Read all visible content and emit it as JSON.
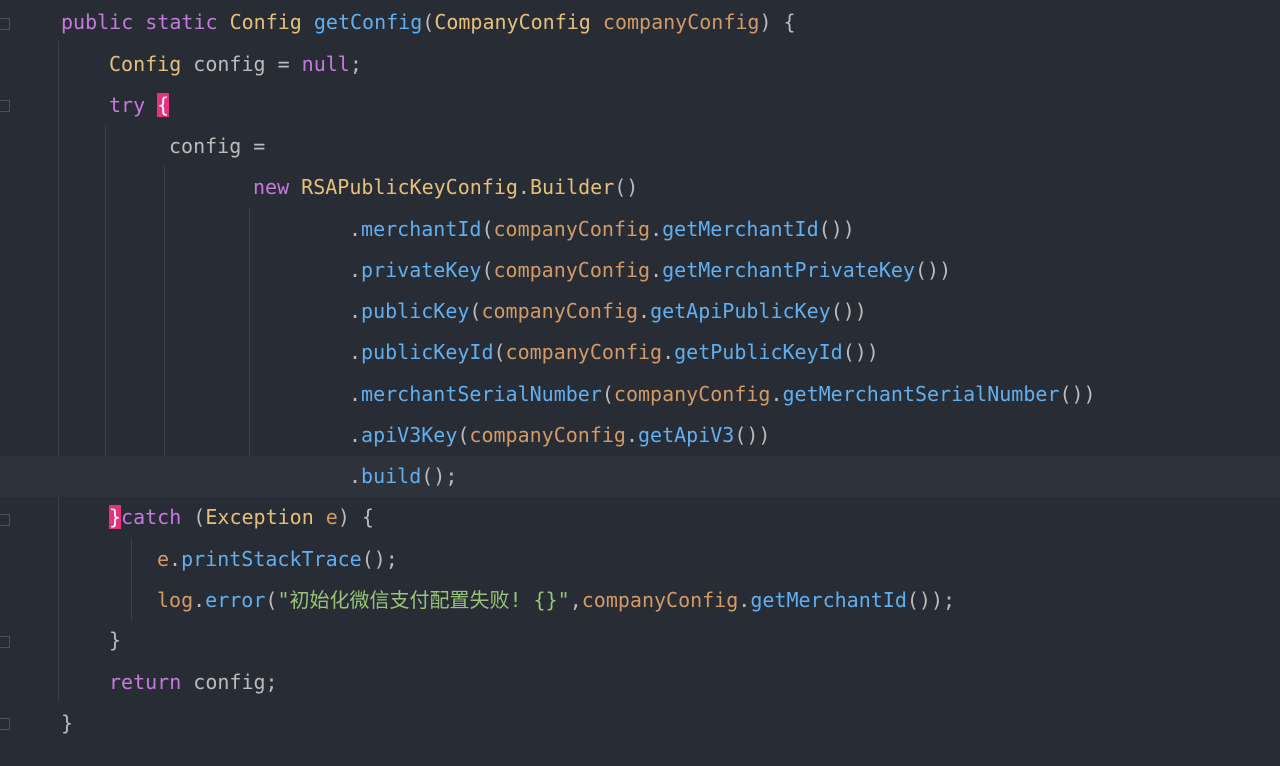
{
  "editor": {
    "lines": [
      {
        "tokens": [
          {
            "t": "public",
            "c": "kw"
          },
          {
            "t": " ",
            "c": "pl"
          },
          {
            "t": "static",
            "c": "kw"
          },
          {
            "t": " ",
            "c": "pl"
          },
          {
            "t": "Config",
            "c": "ty"
          },
          {
            "t": " ",
            "c": "pl"
          },
          {
            "t": "getConfig",
            "c": "fn"
          },
          {
            "t": "(",
            "c": "pl"
          },
          {
            "t": "CompanyConfig",
            "c": "ty"
          },
          {
            "t": " ",
            "c": "pl"
          },
          {
            "t": "companyConfig",
            "c": "pa"
          },
          {
            "t": ") {",
            "c": "pl"
          }
        ]
      },
      {
        "tokens": [
          {
            "t": "Config",
            "c": "ty"
          },
          {
            "t": " config = ",
            "c": "pl"
          },
          {
            "t": "null",
            "c": "kw"
          },
          {
            "t": ";",
            "c": "pl"
          }
        ]
      },
      {
        "tokens": [
          {
            "t": "try",
            "c": "kw"
          },
          {
            "t": " ",
            "c": "pl"
          },
          {
            "t": "{",
            "c": "brace-hl"
          }
        ]
      },
      {
        "tokens": [
          {
            "t": "config =",
            "c": "pl"
          }
        ]
      },
      {
        "tokens": [
          {
            "t": "new",
            "c": "kw"
          },
          {
            "t": " ",
            "c": "pl"
          },
          {
            "t": "RSAPublicKeyConfig",
            "c": "ty"
          },
          {
            "t": ".",
            "c": "pl"
          },
          {
            "t": "Builder",
            "c": "ty"
          },
          {
            "t": "()",
            "c": "pl"
          }
        ]
      },
      {
        "tokens": [
          {
            "t": ".",
            "c": "pl"
          },
          {
            "t": "merchantId",
            "c": "fn"
          },
          {
            "t": "(",
            "c": "pl"
          },
          {
            "t": "companyConfig",
            "c": "pa"
          },
          {
            "t": ".",
            "c": "pl"
          },
          {
            "t": "getMerchantId",
            "c": "fn"
          },
          {
            "t": "())",
            "c": "pl"
          }
        ]
      },
      {
        "tokens": [
          {
            "t": ".",
            "c": "pl"
          },
          {
            "t": "privateKey",
            "c": "fn"
          },
          {
            "t": "(",
            "c": "pl"
          },
          {
            "t": "companyConfig",
            "c": "pa"
          },
          {
            "t": ".",
            "c": "pl"
          },
          {
            "t": "getMerchantPrivateKey",
            "c": "fn"
          },
          {
            "t": "())",
            "c": "pl"
          }
        ]
      },
      {
        "tokens": [
          {
            "t": ".",
            "c": "pl"
          },
          {
            "t": "publicKey",
            "c": "fn"
          },
          {
            "t": "(",
            "c": "pl"
          },
          {
            "t": "companyConfig",
            "c": "pa"
          },
          {
            "t": ".",
            "c": "pl"
          },
          {
            "t": "getApiPublicKey",
            "c": "fn"
          },
          {
            "t": "())",
            "c": "pl"
          }
        ]
      },
      {
        "tokens": [
          {
            "t": ".",
            "c": "pl"
          },
          {
            "t": "publicKeyId",
            "c": "fn"
          },
          {
            "t": "(",
            "c": "pl"
          },
          {
            "t": "companyConfig",
            "c": "pa"
          },
          {
            "t": ".",
            "c": "pl"
          },
          {
            "t": "getPublicKeyId",
            "c": "fn"
          },
          {
            "t": "())",
            "c": "pl"
          }
        ]
      },
      {
        "tokens": [
          {
            "t": ".",
            "c": "pl"
          },
          {
            "t": "merchantSerialNumber",
            "c": "fn"
          },
          {
            "t": "(",
            "c": "pl"
          },
          {
            "t": "companyConfig",
            "c": "pa"
          },
          {
            "t": ".",
            "c": "pl"
          },
          {
            "t": "getMerchantSerialNumber",
            "c": "fn"
          },
          {
            "t": "())",
            "c": "pl"
          }
        ]
      },
      {
        "tokens": [
          {
            "t": ".",
            "c": "pl"
          },
          {
            "t": "apiV3Key",
            "c": "fn"
          },
          {
            "t": "(",
            "c": "pl"
          },
          {
            "t": "companyConfig",
            "c": "pa"
          },
          {
            "t": ".",
            "c": "pl"
          },
          {
            "t": "getApiV3",
            "c": "fn"
          },
          {
            "t": "())",
            "c": "pl"
          }
        ]
      },
      {
        "tokens": [
          {
            "t": ".",
            "c": "pl"
          },
          {
            "t": "build",
            "c": "fn"
          },
          {
            "t": "();",
            "c": "pl"
          }
        ]
      },
      {
        "tokens": [
          {
            "t": "}",
            "c": "brace-hl"
          },
          {
            "t": "catch",
            "c": "kw"
          },
          {
            "t": " (",
            "c": "pl"
          },
          {
            "t": "Exception",
            "c": "ty"
          },
          {
            "t": " ",
            "c": "pl"
          },
          {
            "t": "e",
            "c": "pa"
          },
          {
            "t": ") {",
            "c": "pl"
          }
        ]
      },
      {
        "tokens": [
          {
            "t": "e",
            "c": "pa"
          },
          {
            "t": ".",
            "c": "pl"
          },
          {
            "t": "printStackTrace",
            "c": "fn"
          },
          {
            "t": "();",
            "c": "pl"
          }
        ]
      },
      {
        "tokens": [
          {
            "t": "log",
            "c": "pa"
          },
          {
            "t": ".",
            "c": "pl"
          },
          {
            "t": "error",
            "c": "fn"
          },
          {
            "t": "(",
            "c": "pl"
          },
          {
            "t": "\"初始化微信支付配置失败! {}\"",
            "c": "st"
          },
          {
            "t": ",",
            "c": "pl"
          },
          {
            "t": "companyConfig",
            "c": "pa"
          },
          {
            "t": ".",
            "c": "pl"
          },
          {
            "t": "getMerchantId",
            "c": "fn"
          },
          {
            "t": "());",
            "c": "pl"
          }
        ]
      },
      {
        "tokens": [
          {
            "t": "}",
            "c": "pl"
          }
        ]
      },
      {
        "tokens": [
          {
            "t": "return",
            "c": "kw"
          },
          {
            "t": " config;",
            "c": "pl"
          }
        ]
      },
      {
        "tokens": [
          {
            "t": "}",
            "c": "pl"
          }
        ]
      }
    ]
  }
}
